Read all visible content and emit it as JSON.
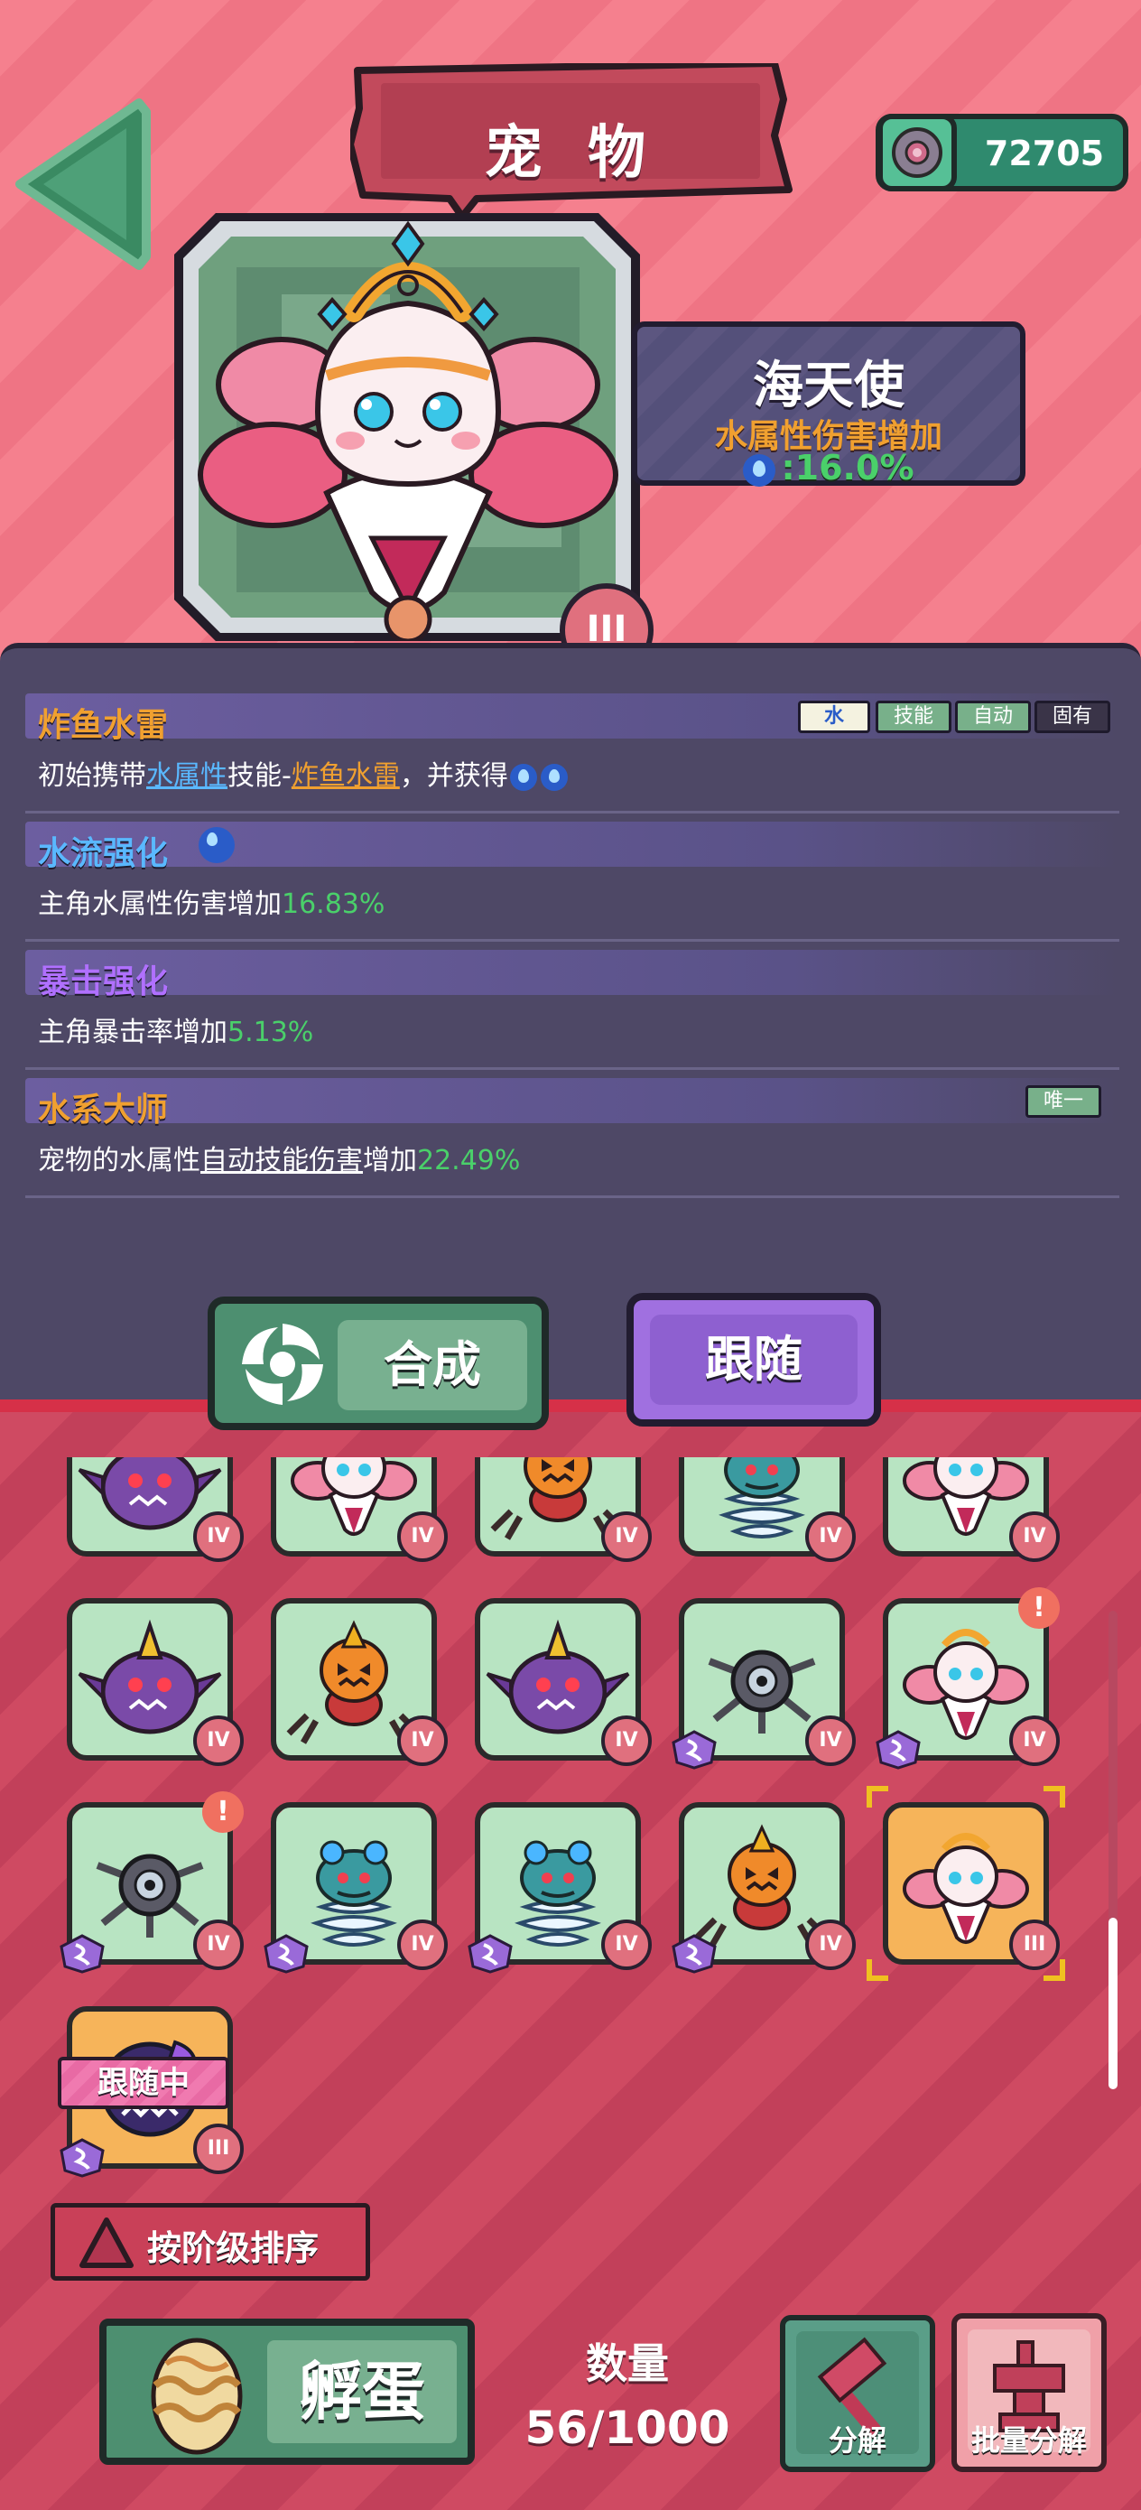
{
  "header": {
    "title": "宠 物",
    "back_icon": "back-arrow-icon",
    "currency_value": "72705",
    "currency_icon": "gem-coin-icon"
  },
  "featured_pet": {
    "name": "海天使",
    "bonus_label": "水属性伤害增加",
    "bonus_value": ":16.0%",
    "grade": "III"
  },
  "skills": [
    {
      "title": "炸鱼水雷",
      "title_color": "#f0a030",
      "tags": [
        "水",
        "技能",
        "自动",
        "固有"
      ],
      "desc_parts": [
        "初始携带",
        "水属性",
        "技能-",
        "炸鱼水雷",
        "，并获得"
      ]
    },
    {
      "title": "水流强化",
      "title_color": "#5ab8ff",
      "desc_parts": [
        "主角水属性伤害增加",
        "16.83%"
      ]
    },
    {
      "title": "暴击强化",
      "title_color": "#b070ff",
      "desc_parts": [
        "主角暴击率增加",
        "5.13%"
      ]
    },
    {
      "title": "水系大师",
      "title_color": "#f0a030",
      "tags": [
        "唯一"
      ],
      "desc_parts": [
        "宠物的水属性",
        "自动技能伤害",
        "增加",
        "22.49%"
      ]
    }
  ],
  "actions": {
    "merge_label": "合成",
    "follow_label": "跟随"
  },
  "grid": {
    "following_label": "跟随中",
    "cards": [
      {
        "pet": "purple-horn-monster",
        "tier": "IV"
      },
      {
        "pet": "sea-angel",
        "tier": "IV"
      },
      {
        "pet": "pumpkin-spider",
        "tier": "IV"
      },
      {
        "pet": "cyclone-frog",
        "tier": "IV"
      },
      {
        "pet": "sea-angel",
        "tier": "IV"
      },
      {
        "pet": "purple-horn-monster",
        "tier": "IV"
      },
      {
        "pet": "pumpkin-spider",
        "tier": "IV"
      },
      {
        "pet": "purple-horn-monster",
        "tier": "IV"
      },
      {
        "pet": "eye-drone",
        "tier": "IV"
      },
      {
        "pet": "sea-angel",
        "tier": "IV"
      },
      {
        "pet": "eye-drone",
        "tier": "IV"
      },
      {
        "pet": "cyclone-frog",
        "tier": "IV"
      },
      {
        "pet": "cyclone-frog",
        "tier": "IV"
      },
      {
        "pet": "pumpkin-spider",
        "tier": "IV"
      },
      {
        "pet": "sea-angel",
        "tier": "III"
      },
      {
        "pet": "shadow-beast",
        "tier": "III"
      }
    ],
    "alert_mark": "!"
  },
  "sort": {
    "label": "按阶级排序"
  },
  "hatch": {
    "label": "孵蛋"
  },
  "count": {
    "label": "数量",
    "value": "56/1000"
  },
  "decompose": {
    "label": "分解"
  },
  "bulk_decompose": {
    "label": "批量分解"
  },
  "colors": {
    "accent_green": "#4d8f70",
    "accent_purple": "#a070e0",
    "panel": "#4e4866",
    "value_green": "#4ad06a"
  }
}
